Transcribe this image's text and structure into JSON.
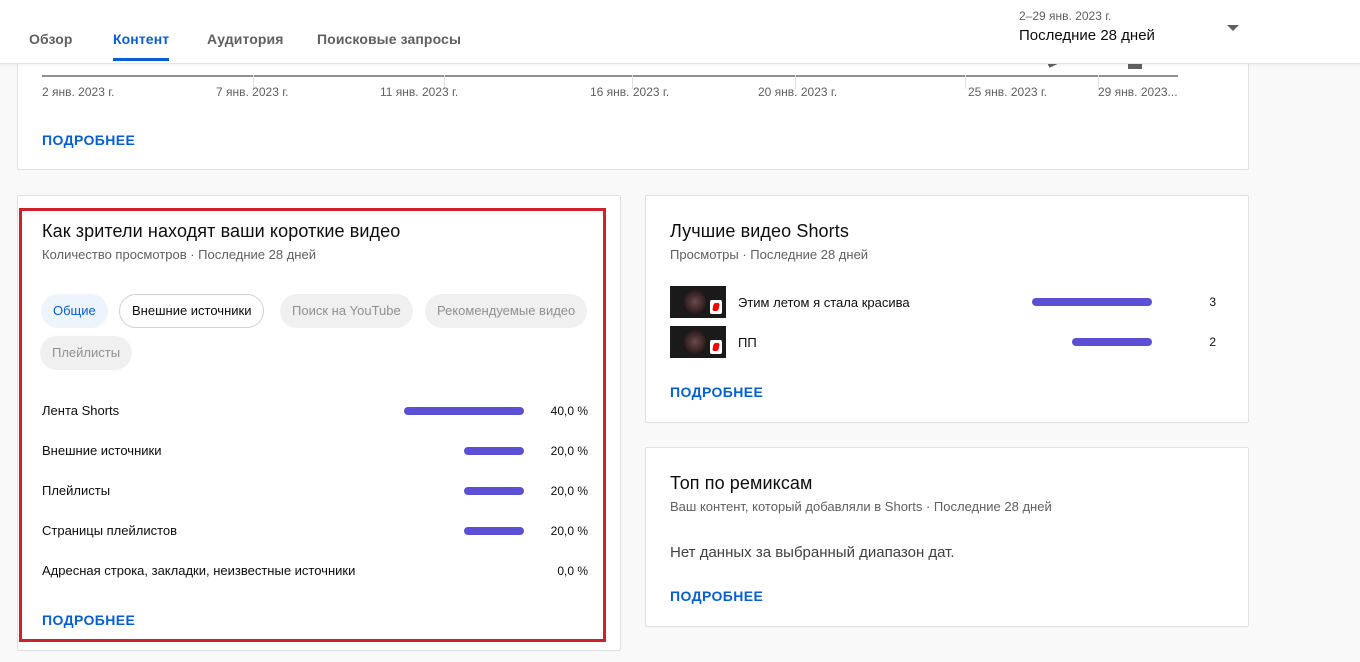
{
  "header": {
    "tabs": [
      {
        "label": "Обзор",
        "active": false
      },
      {
        "label": "Контент",
        "active": true
      },
      {
        "label": "Аудитория",
        "active": false
      },
      {
        "label": "Поисковые запросы",
        "active": false
      }
    ],
    "date_range": "2–29 янв. 2023 г.",
    "period": "Последние 28 дней"
  },
  "chart_card": {
    "x_labels": [
      "2 янв. 2023 г.",
      "7 янв. 2023 г.",
      "11 янв. 2023 г.",
      "16 янв. 2023 г.",
      "20 янв. 2023 г.",
      "25 янв. 2023 г.",
      "29 янв. 2023..."
    ],
    "more": "ПОДРОБНЕЕ"
  },
  "sources_card": {
    "title": "Как зрители находят ваши короткие видео",
    "subtitle": "Количество просмотров · Последние 28 дней",
    "chips": [
      {
        "label": "Общие",
        "state": "selected"
      },
      {
        "label": "Внешние источники",
        "state": "outlined"
      },
      {
        "label": "Поиск на YouTube",
        "state": "disabled"
      },
      {
        "label": "Рекомендуемые видео",
        "state": "disabled"
      },
      {
        "label": "Плейлисты",
        "state": "disabled"
      }
    ],
    "rows": [
      {
        "label": "Лента Shorts",
        "value": "40,0 %",
        "share": 40
      },
      {
        "label": "Внешние источники",
        "value": "20,0 %",
        "share": 20
      },
      {
        "label": "Плейлисты",
        "value": "20,0 %",
        "share": 20
      },
      {
        "label": "Страницы плейлистов",
        "value": "20,0 %",
        "share": 20
      },
      {
        "label": "Адресная строка, закладки, неизвестные источники",
        "value": "0,0 %",
        "share": 0
      }
    ],
    "more": "ПОДРОБНЕЕ"
  },
  "shorts_card": {
    "title": "Лучшие видео Shorts",
    "subtitle": "Просмотры · Последние 28 дней",
    "videos": [
      {
        "title": "Этим летом я стала красива",
        "value": "3",
        "views": 3
      },
      {
        "title": "ПП",
        "value": "2",
        "views": 2
      }
    ],
    "more": "ПОДРОБНЕЕ"
  },
  "remix_card": {
    "title": "Топ по ремиксам",
    "subtitle": "Ваш контент, который добавляли в Shorts · Последние 28 дней",
    "empty": "Нет данных за выбранный диапазон дат.",
    "more": "ПОДРОБНЕЕ"
  },
  "colors": {
    "accent": "#065fd4",
    "bar": "#5b4fd6",
    "highlight": "#d0212b"
  }
}
